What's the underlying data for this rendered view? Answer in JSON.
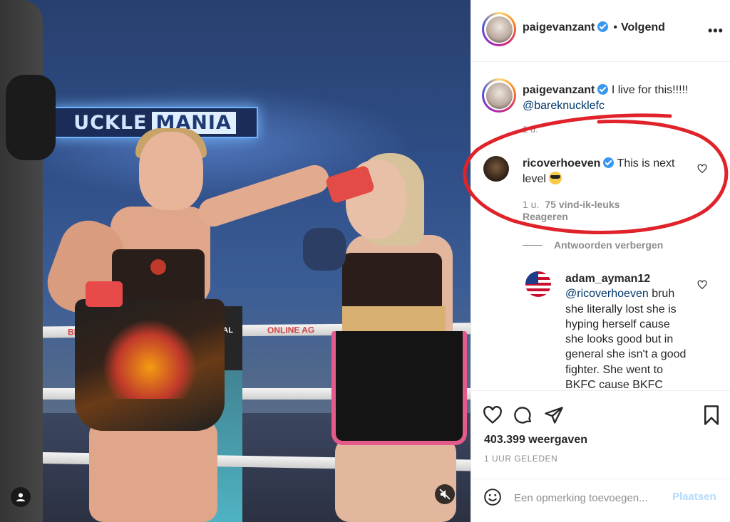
{
  "media": {
    "banner_left": "UCKLE",
    "banner_right": "MANIA",
    "rope_text_1": "BET",
    "rope_text_2": "ONLINE AG",
    "post_text": "UNREAL"
  },
  "header": {
    "username": "paigevanzant",
    "follow_label": "Volgend",
    "dot": "•",
    "more": "•••"
  },
  "caption": {
    "username": "paigevanzant",
    "text": "I live for this!!!!!",
    "mention": "@bareknucklefc",
    "time": "1 u."
  },
  "comment_rico": {
    "username": "ricoverhoeven",
    "text": "This is next level",
    "emoji": "sunglasses-emoji",
    "time": "1 u.",
    "likes": "75 vind-ik-leuks",
    "reply": "Reageren"
  },
  "hide_replies": "Antwoorden verbergen",
  "comment_adam": {
    "username": "adam_ayman12",
    "mention": "@ricoverhoeven",
    "text": "bruh she literally lost she is hyping herself cause she looks good but in general she isn't a good fighter. She went to BKFC cause BKFC"
  },
  "stats": {
    "views": "403.399 weergaven",
    "ago": "1 UUR GELEDEN"
  },
  "add_comment": {
    "placeholder": "Een opmerking toevoegen...",
    "post_label": "Plaatsen"
  },
  "colors": {
    "verified": "#3897f0",
    "mention": "#00376b",
    "annotation": "#e0222a",
    "post_disabled": "#b3dbff"
  }
}
